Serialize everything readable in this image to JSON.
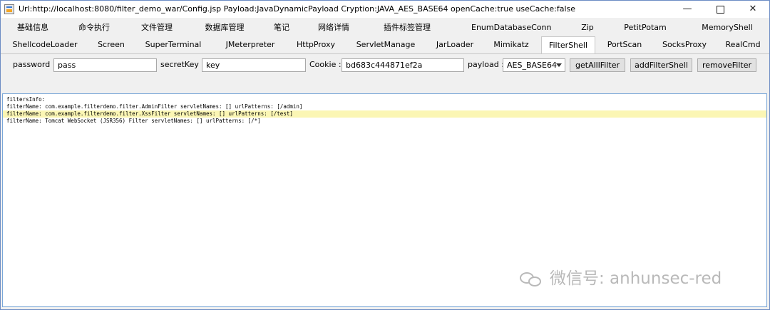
{
  "window": {
    "title": "Url:http://localhost:8080/filter_demo_war/Config.jsp Payload:JavaDynamicPayload Cryption:JAVA_AES_BASE64 openCache:true useCache:false",
    "controls": {
      "minimize": "—",
      "maximize": "",
      "close": "✕"
    }
  },
  "tabs_row1": [
    "基础信息",
    "命令执行",
    "文件管理",
    "数据库管理",
    "笔记",
    "网络详情",
    "插件标签管理",
    "EnumDatabaseConn",
    "Zip",
    "PetitPotam",
    "MemoryShell"
  ],
  "tabs_row2": [
    "ShellcodeLoader",
    "Screen",
    "SuperTerminal",
    "JMeterpreter",
    "HttpProxy",
    "ServletManage",
    "JarLoader",
    "Mimikatz",
    "FilterShell",
    "PortScan",
    "SocksProxy",
    "RealCmd"
  ],
  "active_tab": "FilterShell",
  "form": {
    "password_label": "password :",
    "password_value": "pass",
    "secretkey_label": "secretKey :",
    "secretkey_value": "key",
    "cookie_label": "Cookie :",
    "cookie_value": "bd683c444871ef2a",
    "payload_label": "payload :",
    "payload_value": "AES_BASE64",
    "btn_get_all": "getAlllFilter",
    "btn_add": "addFilterShell",
    "btn_remove": "removeFilter"
  },
  "output": {
    "lines": [
      "filtersInfo:",
      "filterName: com.example.filterdemo.filter.AdminFilter servletNames: [] urlPatterns: [/admin]",
      "filterName: com.example.filterdemo.filter.XssFilter servletNames: [] urlPatterns: [/test]",
      "filterName: Tomcat WebSocket (JSR356) Filter servletNames: [] urlPatterns: [/*]"
    ],
    "highlighted_line_index": 2,
    "highlight_color": "#fbf6b4"
  },
  "watermark": {
    "text": "微信号: anhunsec-red"
  },
  "colors": {
    "accent_border": "#7aa7d8",
    "window_bg": "#f0f0f0"
  }
}
